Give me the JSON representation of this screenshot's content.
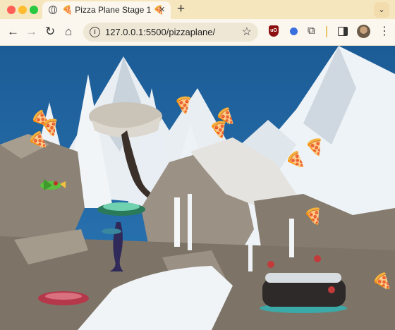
{
  "browser": {
    "tab": {
      "title": "🍕 Pizza Plane Stage 1 🍕"
    },
    "address": {
      "url": "127.0.0.1:5500/pizzaplane/"
    },
    "icons": {
      "close": "close-icon",
      "back": "back-arrow-icon",
      "forward": "forward-arrow-icon",
      "reload": "reload-icon",
      "home": "home-icon",
      "site_info": "info-icon",
      "bookmark": "star-icon",
      "extensions": "puzzle-icon",
      "menu": "kebab-menu-icon"
    }
  },
  "game": {
    "sprites": [
      "pizza-slice",
      "green-pizza-plane",
      "mushroom-tree",
      "red-mushroom",
      "snowy-log"
    ],
    "pizza_count": 10,
    "colors": {
      "sky": "#1d5f99",
      "snow": "#ecf2f7",
      "rock": "#8b8073",
      "plane": "#5cbf3e",
      "water": "#3aa9a8"
    }
  }
}
